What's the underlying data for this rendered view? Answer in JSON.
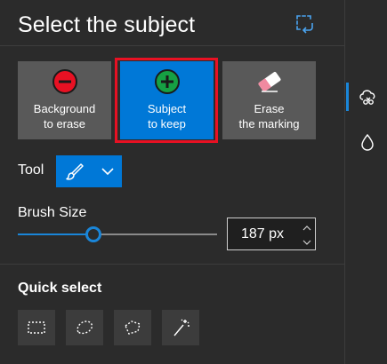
{
  "panel": {
    "title": "Select the subject"
  },
  "modes": [
    {
      "label": "Background\nto erase",
      "icon": "minus-circle-icon",
      "selected": false
    },
    {
      "label": "Subject\nto keep",
      "icon": "plus-circle-icon",
      "selected": true
    },
    {
      "label": "Erase\nthe marking",
      "icon": "eraser-icon",
      "selected": false
    }
  ],
  "tool": {
    "label": "Tool",
    "current_icon": "brush-icon"
  },
  "brush": {
    "label": "Brush Size",
    "value": "187 px",
    "slider_fraction": 0.38
  },
  "quick_select": {
    "label": "Quick select",
    "tools": [
      "rectangle-select-icon",
      "lasso-select-icon",
      "polygon-lasso-icon",
      "magic-wand-icon"
    ]
  },
  "rail": {
    "items": [
      "subject-select-icon",
      "drop-icon"
    ],
    "active_index": 0
  },
  "colors": {
    "accent": "#0078d7",
    "highlight_outline": "#e81123",
    "panel_bg": "#2b2b2b",
    "button_bg": "#595959"
  }
}
